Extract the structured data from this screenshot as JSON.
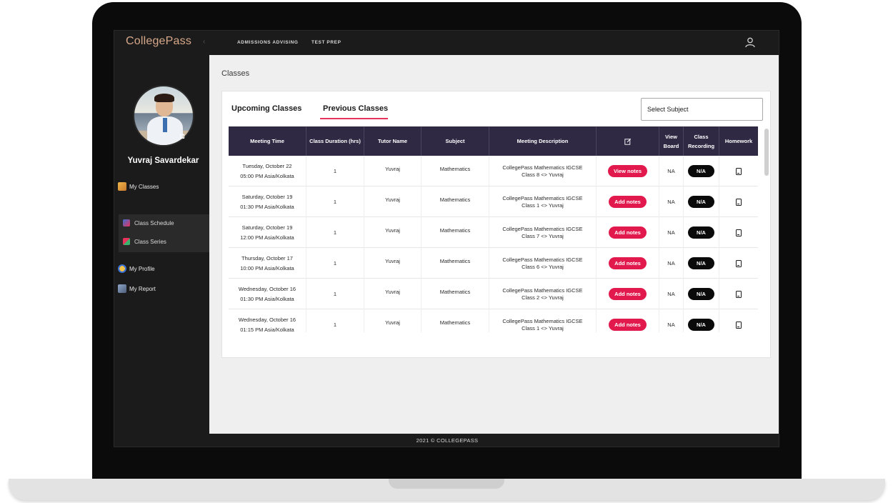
{
  "app": {
    "brand": "CollegePass",
    "footer": "2021 © COLLEGEPASS"
  },
  "topnav": {
    "items": [
      "ADMISSIONS ADVISING",
      "TEST PREP"
    ]
  },
  "sidebar": {
    "user_name": "Yuvraj Savardekar",
    "items": [
      {
        "label": "My Classes",
        "icon": "classes-icon"
      },
      {
        "label": "Class Schedule",
        "icon": "schedule-icon"
      },
      {
        "label": "Class Series",
        "icon": "series-icon"
      },
      {
        "label": "My Profile",
        "icon": "profile-icon"
      },
      {
        "label": "My Report",
        "icon": "report-icon"
      }
    ]
  },
  "main": {
    "title": "Classes",
    "tabs": [
      "Upcoming Classes",
      "Previous Classes"
    ],
    "active_tab": "Previous Classes",
    "subject_select": "Select Subject",
    "columns": [
      "Meeting Time",
      "Class Duration (hrs)",
      "Tutor Name",
      "Subject",
      "Meeting Description",
      "edit-icon",
      "View Board",
      "Class Recording",
      "Homework"
    ],
    "rows": [
      {
        "day": "Tuesday, October 22",
        "time": "05:00 PM Asia/Kolkata",
        "duration": "1",
        "tutor": "Yuvraj",
        "subject": "Mathematics",
        "desc1": "CollegePass Mathematics IGCSE",
        "desc2": "Class 8 <> Yuvraj",
        "notes": "View notes",
        "board": "NA",
        "recording": "N/A"
      },
      {
        "day": "Saturday, October 19",
        "time": "01:30 PM Asia/Kolkata",
        "duration": "1",
        "tutor": "Yuvraj",
        "subject": "Mathematics",
        "desc1": "CollegePass Mathematics IGCSE",
        "desc2": "Class 1 <> Yuvraj",
        "notes": "Add notes",
        "board": "NA",
        "recording": "N/A"
      },
      {
        "day": "Saturday, October 19",
        "time": "12:00 PM Asia/Kolkata",
        "duration": "1",
        "tutor": "Yuvraj",
        "subject": "Mathematics",
        "desc1": "CollegePass Mathematics IGCSE",
        "desc2": "Class 7 <> Yuvraj",
        "notes": "Add notes",
        "board": "NA",
        "recording": "N/A"
      },
      {
        "day": "Thursday, October 17",
        "time": "10:00 PM Asia/Kolkata",
        "duration": "1",
        "tutor": "Yuvraj",
        "subject": "Mathematics",
        "desc1": "CollegePass Mathematics IGCSE",
        "desc2": "Class 6 <> Yuvraj",
        "notes": "Add notes",
        "board": "NA",
        "recording": "N/A"
      },
      {
        "day": "Wednesday, October 16",
        "time": "01:30 PM Asia/Kolkata",
        "duration": "1",
        "tutor": "Yuvraj",
        "subject": "Mathematics",
        "desc1": "CollegePass Mathematics IGCSE",
        "desc2": "Class 2 <> Yuvraj",
        "notes": "Add notes",
        "board": "NA",
        "recording": "N/A"
      },
      {
        "day": "Wednesday, October 16",
        "time": "01:15 PM Asia/Kolkata",
        "duration": "1",
        "tutor": "Yuvraj",
        "subject": "Mathematics",
        "desc1": "CollegePass Mathematics IGCSE",
        "desc2": "Class 1 <> Yuvraj",
        "notes": "Add notes",
        "board": "NA",
        "recording": "N/A"
      }
    ]
  },
  "colors": {
    "accent": "#e2194d",
    "header": "#2f2944",
    "dark": "#1b1b1b",
    "brand": "#d8a88a"
  }
}
